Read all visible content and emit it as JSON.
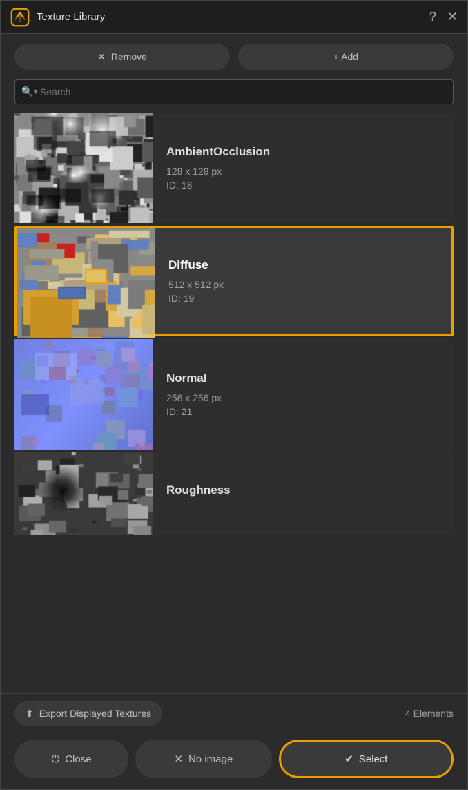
{
  "titlebar": {
    "title": "Texture Library",
    "help_label": "?",
    "close_label": "✕"
  },
  "toolbar": {
    "remove_label": "Remove",
    "add_label": "+ Add",
    "remove_icon": "✕"
  },
  "search": {
    "placeholder": "Search..."
  },
  "textures": [
    {
      "id": 0,
      "name": "AmbientOcclusion",
      "size": "128 x 128 px",
      "id_label": "ID: 18",
      "selected": false,
      "thumb_type": "ao"
    },
    {
      "id": 1,
      "name": "Diffuse",
      "size": "512 x 512 px",
      "id_label": "ID: 19",
      "selected": true,
      "thumb_type": "diffuse"
    },
    {
      "id": 2,
      "name": "Normal",
      "size": "256 x 256 px",
      "id_label": "ID: 21",
      "selected": false,
      "thumb_type": "normal"
    },
    {
      "id": 3,
      "name": "Roughness",
      "size": "",
      "id_label": "",
      "selected": false,
      "thumb_type": "roughness"
    }
  ],
  "bottom": {
    "export_label": "Export Displayed Textures",
    "export_icon": "⬆",
    "elements_label": "4 Elements",
    "close_label": "Close",
    "close_icon": "⏻",
    "noimage_label": "No image",
    "noimage_icon": "✕",
    "select_label": "Select",
    "select_icon": "✔"
  }
}
